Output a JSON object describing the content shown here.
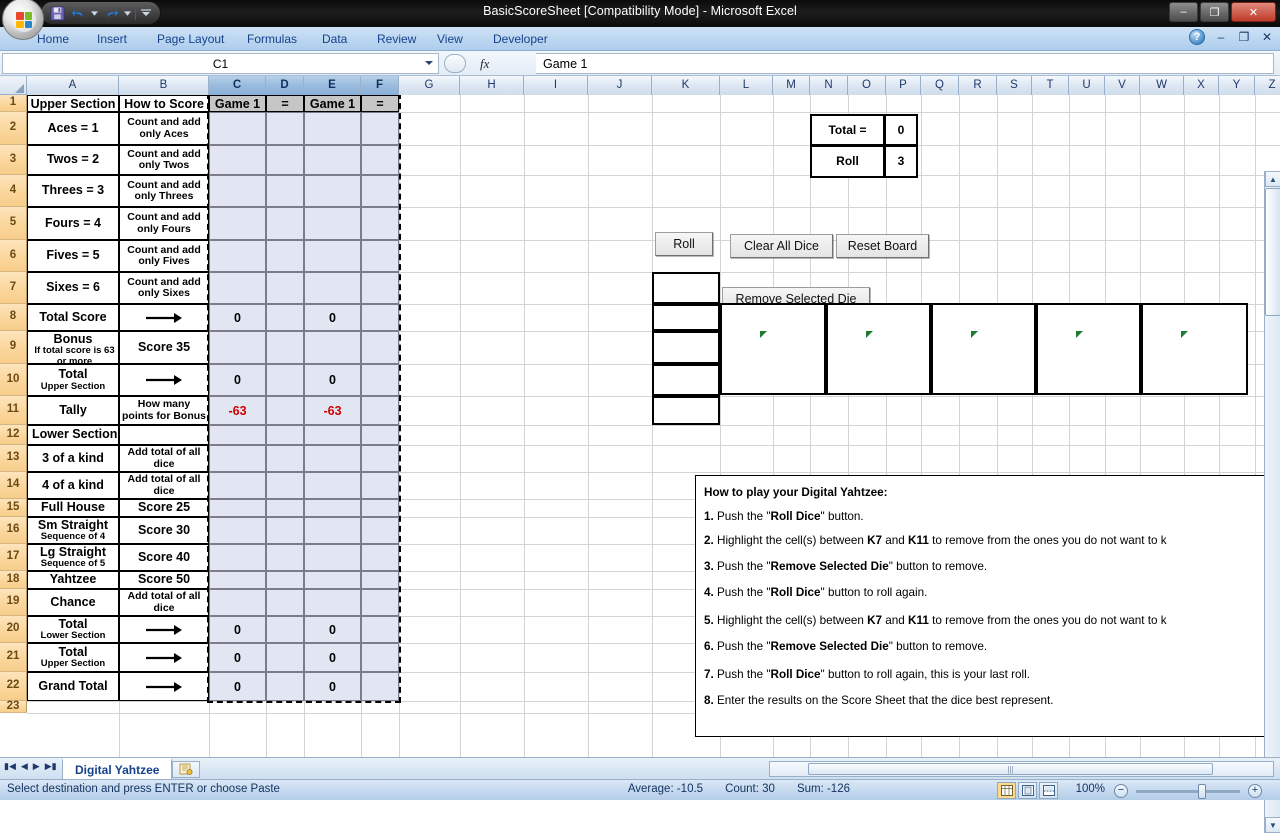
{
  "window": {
    "title": "BasicScoreSheet  [Compatibility Mode] - Microsoft Excel",
    "minimize": "–",
    "restore": "❐",
    "close": "✕"
  },
  "quick_access": {
    "save": "save-icon",
    "undo": "undo-icon",
    "redo": "redo-icon",
    "customize": "customize-icon"
  },
  "ribbon": {
    "tabs": [
      {
        "label": "Home"
      },
      {
        "label": "Insert"
      },
      {
        "label": "Page Layout"
      },
      {
        "label": "Formulas"
      },
      {
        "label": "Data"
      },
      {
        "label": "Review"
      },
      {
        "label": "View"
      },
      {
        "label": "Developer"
      }
    ],
    "help": "?",
    "minimize": "–",
    "restore": "❐",
    "close": "✕"
  },
  "formula_bar": {
    "name_box": "C1",
    "fx_label": "fx",
    "formula_value": "Game 1"
  },
  "grid": {
    "columns": [
      "A",
      "B",
      "C",
      "D",
      "E",
      "F",
      "G",
      "H",
      "I",
      "J",
      "K",
      "L",
      "M",
      "N",
      "O",
      "P",
      "Q",
      "R",
      "S",
      "T",
      "U",
      "V",
      "W",
      "X",
      "Y",
      "Z"
    ],
    "selected_columns": [
      "C",
      "D",
      "E",
      "F"
    ],
    "rows": [
      "1",
      "2",
      "3",
      "4",
      "5",
      "6",
      "7",
      "8",
      "9",
      "10",
      "11",
      "12",
      "13",
      "14",
      "15",
      "16",
      "17",
      "18",
      "19",
      "20",
      "21",
      "22",
      "23"
    ]
  },
  "scoresheet": {
    "headers": [
      "Upper Section",
      "How to Score",
      "Game 1",
      "=",
      "Game 1",
      "="
    ],
    "rows": [
      {
        "label": "Aces = 1",
        "sub": "",
        "how": "Count and add only Aces",
        "c": "",
        "e": ""
      },
      {
        "label": "Twos = 2",
        "sub": "",
        "how": "Count and add only Twos",
        "c": "",
        "e": ""
      },
      {
        "label": "Threes = 3",
        "sub": "",
        "how": "Count and add only Threes",
        "c": "",
        "e": ""
      },
      {
        "label": "Fours = 4",
        "sub": "",
        "how": "Count and add only Fours",
        "c": "",
        "e": ""
      },
      {
        "label": "Fives = 5",
        "sub": "",
        "how": "Count and add only Fives",
        "c": "",
        "e": ""
      },
      {
        "label": "Sixes = 6",
        "sub": "",
        "how": "Count and add only Sixes",
        "c": "",
        "e": ""
      },
      {
        "label": "Total Score",
        "sub": "",
        "how": "→",
        "c": "0",
        "e": "0"
      },
      {
        "label": "Bonus",
        "sub": "If total score is 63 or more",
        "how": "Score 35",
        "c": "",
        "e": ""
      },
      {
        "label": "Total",
        "sub": "Upper Section",
        "how": "→",
        "c": "0",
        "e": "0"
      },
      {
        "label": "Tally",
        "sub": "",
        "how": "How many points for Bonus",
        "c": "-63",
        "e": "-63",
        "negative": true
      },
      {
        "label": "Lower Section",
        "sub": "",
        "how": "",
        "c": "",
        "e": "",
        "section": true
      },
      {
        "label": "3 of a kind",
        "sub": "",
        "how": "Add total of all dice",
        "c": "",
        "e": ""
      },
      {
        "label": "4 of a kind",
        "sub": "",
        "how": "Add total of all dice",
        "c": "",
        "e": ""
      },
      {
        "label": "Full House",
        "sub": "",
        "how": "Score 25",
        "c": "",
        "e": ""
      },
      {
        "label": "Sm Straight",
        "sub": "Sequence of 4",
        "how": "Score 30",
        "c": "",
        "e": ""
      },
      {
        "label": "Lg Straight",
        "sub": "Sequence of 5",
        "how": "Score 40",
        "c": "",
        "e": ""
      },
      {
        "label": "Yahtzee",
        "sub": "",
        "how": "Score 50",
        "c": "",
        "e": ""
      },
      {
        "label": "Chance",
        "sub": "",
        "how": "Add total of all dice",
        "c": "",
        "e": ""
      },
      {
        "label": "Total",
        "sub": "Lower Section",
        "how": "→",
        "c": "0",
        "e": "0"
      },
      {
        "label": "Total",
        "sub": "Upper Section",
        "how": "→",
        "c": "0",
        "e": "0"
      },
      {
        "label": "Grand Total",
        "sub": "",
        "how": "→",
        "c": "0",
        "e": "0"
      }
    ]
  },
  "game_panel": {
    "total_label": "Total =",
    "total_value": "0",
    "roll_label": "Roll",
    "roll_value": "3",
    "buttons": [
      {
        "label": "Roll"
      },
      {
        "label": "Clear All Dice"
      },
      {
        "label": "Reset Board"
      },
      {
        "label": "Remove Selected Die"
      }
    ],
    "dice_count": 5,
    "k_cells_count": 5,
    "flag_color": "#1f7a33"
  },
  "instructions": {
    "title": "How to play your Digital Yahtzee:",
    "steps": [
      {
        "num": "1.",
        "parts": [
          {
            "t": " Push the \"",
            "b": false
          },
          {
            "t": "Roll Dice",
            "b": true
          },
          {
            "t": "\" button.",
            "b": false
          }
        ]
      },
      {
        "num": "2.",
        "parts": [
          {
            "t": " Highlight the cell(s) between ",
            "b": false
          },
          {
            "t": "K7",
            "b": true
          },
          {
            "t": " and ",
            "b": false
          },
          {
            "t": "K11",
            "b": true
          },
          {
            "t": " to remove from the ones you do not want to k",
            "b": false
          }
        ]
      },
      {
        "num": "3.",
        "parts": [
          {
            "t": " Push the \"",
            "b": false
          },
          {
            "t": "Remove Selected Die",
            "b": true
          },
          {
            "t": "\" button to remove.",
            "b": false
          }
        ]
      },
      {
        "num": "4.",
        "parts": [
          {
            "t": " Push the \"",
            "b": false
          },
          {
            "t": "Roll Dice",
            "b": true
          },
          {
            "t": "\" button to roll again.",
            "b": false
          }
        ]
      },
      {
        "num": "5.",
        "parts": [
          {
            "t": " Highlight the cell(s) between ",
            "b": false
          },
          {
            "t": "K7",
            "b": true
          },
          {
            "t": " and ",
            "b": false
          },
          {
            "t": "K11",
            "b": true
          },
          {
            "t": " to remove from the ones you do not want to k",
            "b": false
          }
        ]
      },
      {
        "num": "6.",
        "parts": [
          {
            "t": " Push the \"",
            "b": false
          },
          {
            "t": "Remove Selected Die",
            "b": true
          },
          {
            "t": "\" button to remove.",
            "b": false
          }
        ]
      },
      {
        "num": "7.",
        "parts": [
          {
            "t": " Push the \"",
            "b": false
          },
          {
            "t": "Roll Dice",
            "b": true
          },
          {
            "t": "\" button to roll again, this is your last roll.",
            "b": false
          }
        ]
      },
      {
        "num": "8.",
        "parts": [
          {
            "t": " Enter the results on the Score Sheet that the dice best represent.",
            "b": false
          }
        ]
      }
    ]
  },
  "sheet_tabs": {
    "active": "Digital Yahtzee",
    "new_sheet": "new-sheet-icon"
  },
  "status_bar": {
    "message": "Select destination and press ENTER or choose Paste",
    "average": "Average: -10.5",
    "count": "Count: 30",
    "sum": "Sum: -126",
    "zoom": "100%",
    "zoom_out": "−",
    "zoom_in": "+",
    "views": [
      "normal-view-icon",
      "page-layout-view-icon",
      "page-break-view-icon"
    ]
  }
}
